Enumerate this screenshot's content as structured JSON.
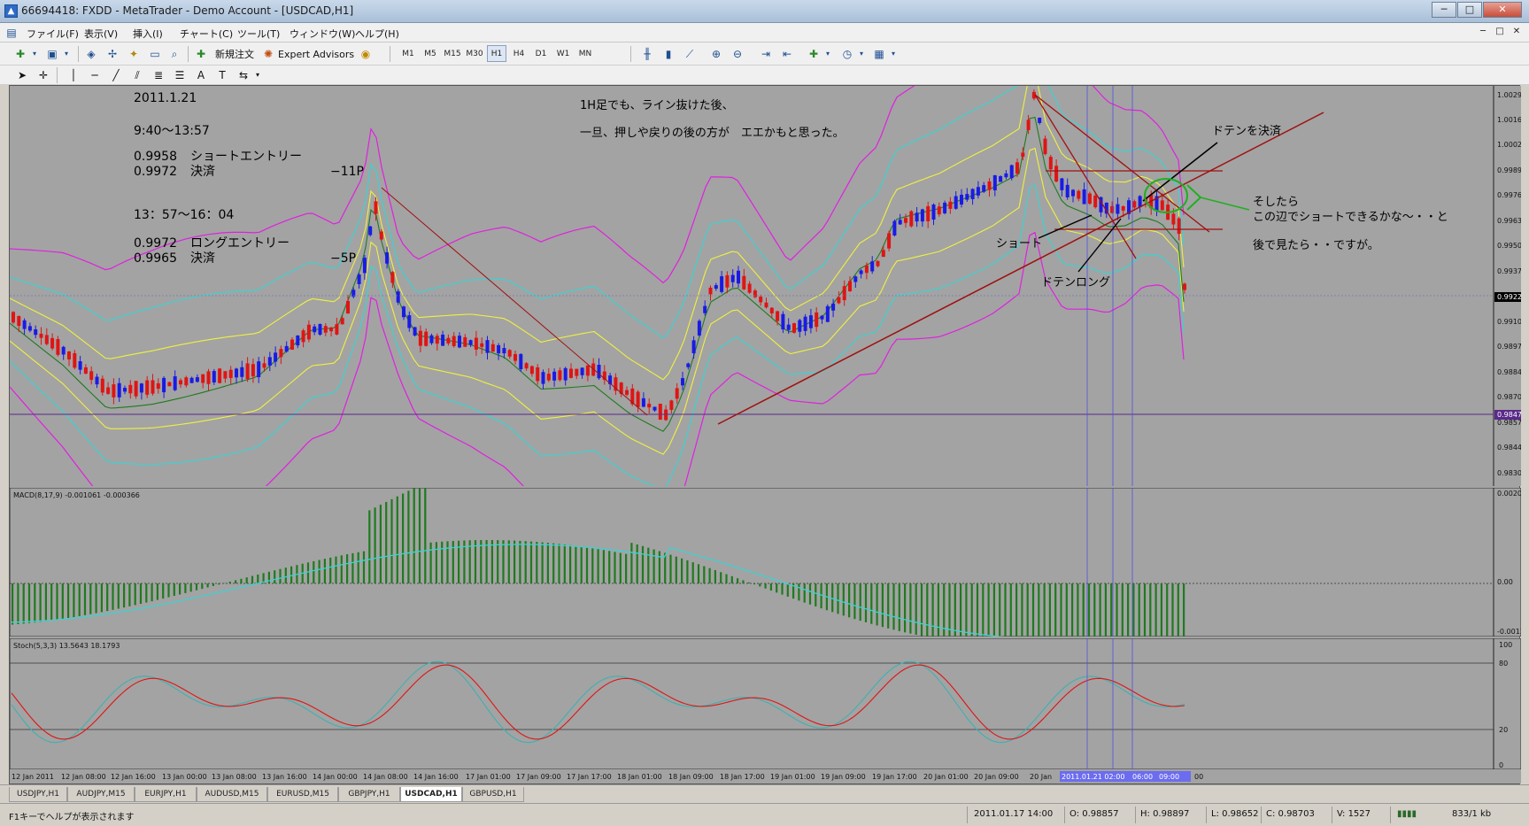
{
  "window": {
    "title": "66694418: FXDD - MetaTrader - Demo Account - [USDCAD,H1]",
    "minimize": "─",
    "maximize": "□",
    "close": "✕"
  },
  "menu": [
    "ファイル(F)",
    "表示(V)",
    "挿入(I)",
    "チャート(C)",
    "ツール(T)",
    "ウィンドウ(W)",
    "ヘルプ(H)"
  ],
  "toolbar": {
    "new_order": "新規注文",
    "expert_advisors": "Expert Advisors",
    "timeframes": [
      "M1",
      "M5",
      "M15",
      "M30",
      "H1",
      "H4",
      "D1",
      "W1",
      "MN"
    ],
    "active_timeframe": "H1"
  },
  "chart": {
    "symbol": "USDCAD,H1",
    "colors": {
      "background": "#a3a3a3",
      "bull": "#1a1ae6",
      "bear": "#e01414",
      "bb_outer": "#e020e0",
      "bb_mid": "#40d0d0",
      "bb_inner": "#f0f040",
      "ma": "#1f7a1f",
      "trend": "#a01010"
    },
    "price_axis": [
      "1.00290",
      "1.00160",
      "1.00025",
      "0.99895",
      "0.99765",
      "0.99630",
      "0.99500",
      "0.99370",
      "0.99235",
      "0.99105",
      "0.98975",
      "0.98840",
      "0.98705",
      "0.98575",
      "0.98440",
      "0.98305"
    ],
    "current_price": "0.99224",
    "hline_price": "0.98472",
    "annotations": {
      "date": "2011.1.21",
      "session1": "9:40〜13:57",
      "entry1_price": "0.9958",
      "entry1_label": "ショートエントリー",
      "exit1_price": "0.9972",
      "exit1_label": "決済",
      "result1": "−11P",
      "session2": "13：57〜16：04",
      "entry2_price": "0.9972",
      "entry2_label": "ロングエントリー",
      "exit2_price": "0.9965",
      "exit2_label": "決済",
      "result2": "−5P",
      "comment1": "1H足でも、ライン抜けた後、",
      "comment2": "一旦、押しや戻りの後の方が　エエかもと思った。",
      "doten_settle": "ドテンを決済",
      "soshitara": "そしたら",
      "konohen": "この辺でショートできるかな〜・・と",
      "atode": "後で見たら・・ですが。",
      "short": "ショート",
      "doten_long": "ドテンロング"
    }
  },
  "macd": {
    "label": "MACD(8,17,9) -0.001061 -0.000366",
    "axis": [
      "0.002022",
      "0.00",
      "-0.00120"
    ]
  },
  "stoch": {
    "label": "Stoch(5,3,3) 13.5643 18.1793",
    "axis": [
      "100",
      "80",
      "20",
      "0"
    ]
  },
  "time_axis": [
    "12 Jan 2011",
    "12 Jan 08:00",
    "12 Jan 16:00",
    "13 Jan 00:00",
    "13 Jan 08:00",
    "13 Jan 16:00",
    "14 Jan 00:00",
    "14 Jan 08:00",
    "14 Jan 16:00",
    "17 Jan 01:00",
    "17 Jan 09:00",
    "17 Jan 17:00",
    "18 Jan 01:00",
    "18 Jan 09:00",
    "18 Jan 17:00",
    "19 Jan 01:00",
    "19 Jan 09:00",
    "19 Jan 17:00",
    "20 Jan 01:00",
    "20 Jan 09:00",
    "20 Jan",
    "2011.01.21 02:00",
    "06:00",
    "09:00",
    "00"
  ],
  "tabs": [
    "USDJPY,H1",
    "AUDJPY,M15",
    "EURJPY,H1",
    "AUDUSD,M15",
    "EURUSD,M15",
    "GBPJPY,H1",
    "USDCAD,H1",
    "GBPUSD,H1"
  ],
  "active_tab": "USDCAD,H1",
  "status": {
    "help": "F1キーでヘルプが表示されます",
    "datetime": "2011.01.17 14:00",
    "open": "O: 0.98857",
    "high": "H: 0.98897",
    "low": "L: 0.98652",
    "close": "C: 0.98703",
    "volume": "V: 1527",
    "traffic": "833/1 kb"
  }
}
